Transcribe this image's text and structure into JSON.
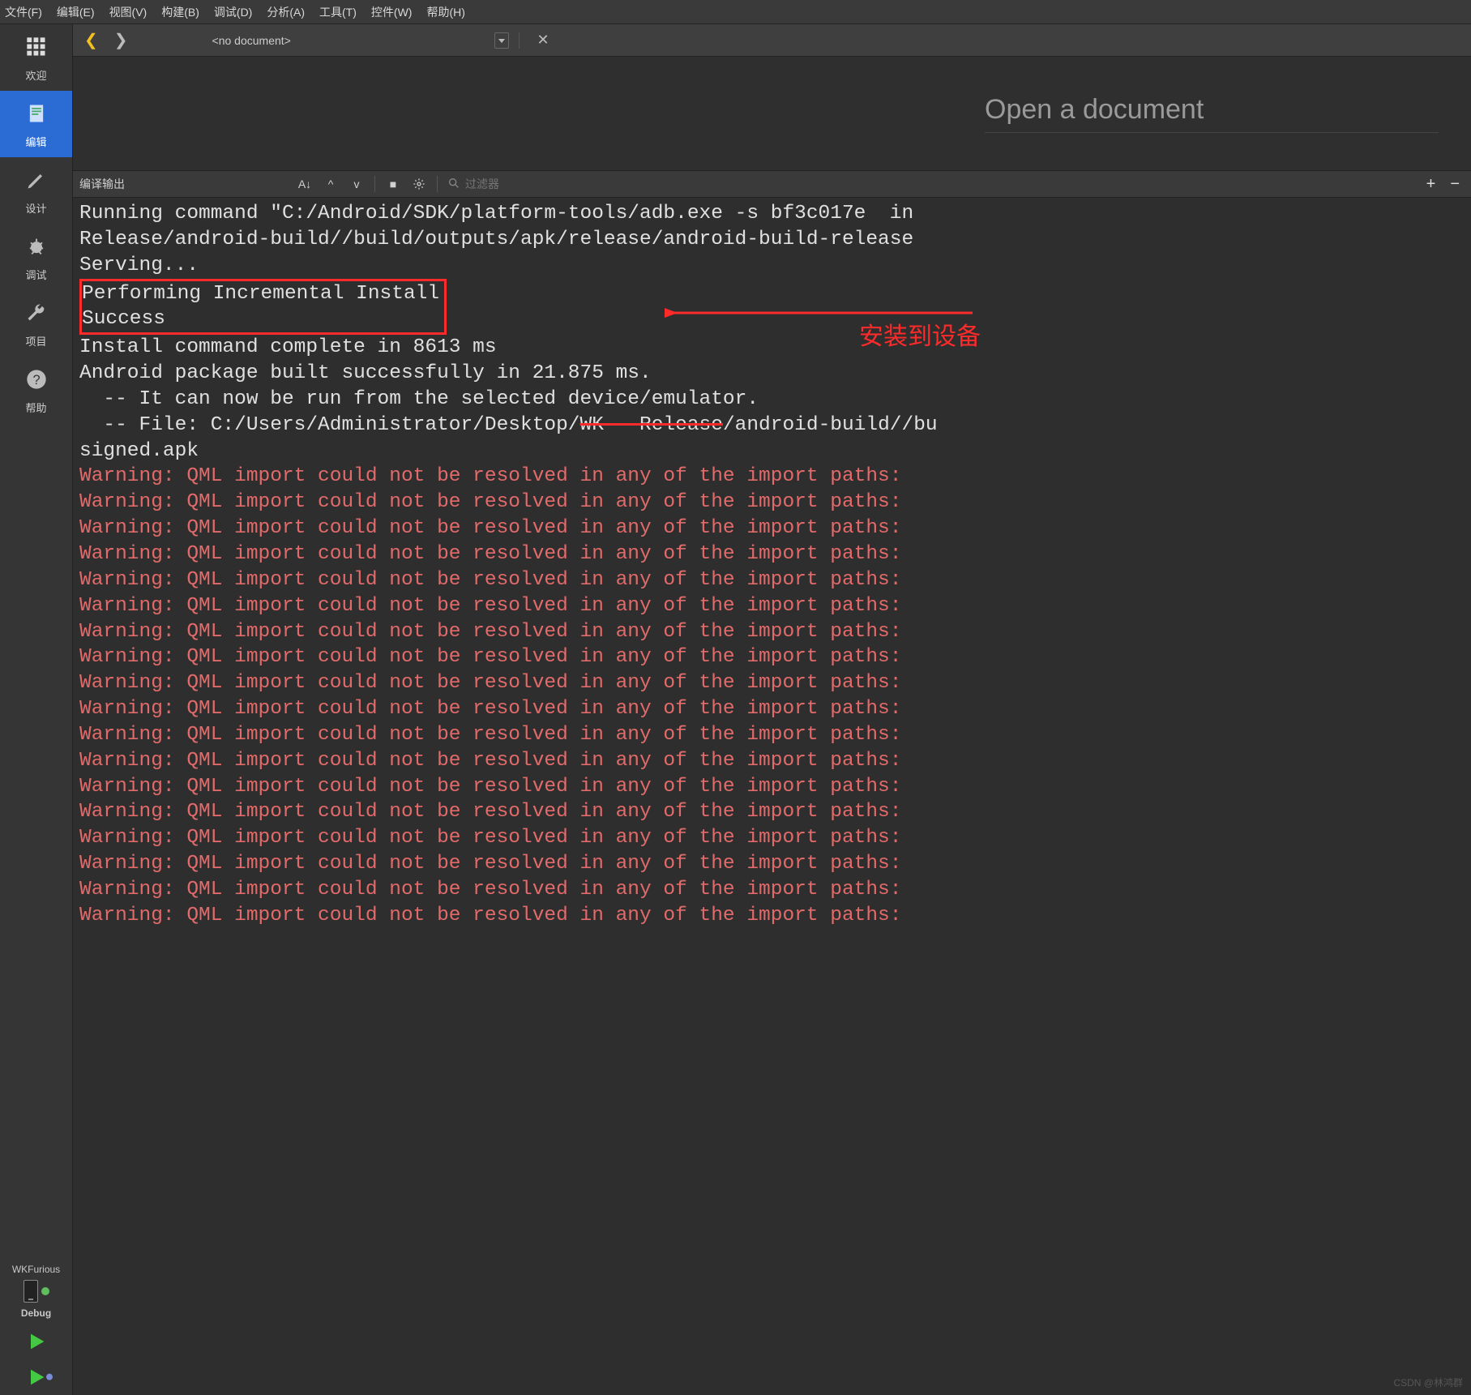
{
  "menu": {
    "file": "文件(F)",
    "edit": "编辑(E)",
    "view": "视图(V)",
    "build": "构建(B)",
    "debug": "调试(D)",
    "analyze": "分析(A)",
    "tools": "工具(T)",
    "controls": "控件(W)",
    "help": "帮助(H)"
  },
  "sidebar": {
    "items": [
      {
        "id": "welcome",
        "label": "欢迎",
        "icon": "grid"
      },
      {
        "id": "editor",
        "label": "编辑",
        "icon": "doc",
        "active": true
      },
      {
        "id": "design",
        "label": "设计",
        "icon": "pencil"
      },
      {
        "id": "debug",
        "label": "调试",
        "icon": "bug"
      },
      {
        "id": "project",
        "label": "项目",
        "icon": "wrench"
      },
      {
        "id": "help",
        "label": "帮助",
        "icon": "question"
      }
    ],
    "kit_name": "WKFurious",
    "build_mode": "Debug"
  },
  "doc_nav": {
    "label": "<no document>"
  },
  "placeholder": {
    "open_doc": "Open a document"
  },
  "out_header": {
    "title": "编译输出",
    "filter_placeholder": "过滤器"
  },
  "output": {
    "lines_normal": [
      "Running command \"C:/Android/SDK/platform-tools/adb.exe -s bf3c017e  in",
      "Release/android-build//build/outputs/apk/release/android-build-release",
      "Serving..."
    ],
    "boxed": [
      "Performing Incremental Install",
      "Success"
    ],
    "after_box": [
      "Install command complete in 8613 ms",
      "Android package built successfully in 21.875 ms.",
      "  -- It can now be run from the selected device/emulator."
    ],
    "file_line_prefix": "  -- File: C:/Users/Administrator/Desktop/",
    "file_line_struck": "WK   Release",
    "file_line_suffix": "/android-build//bu",
    "signed_line": "signed.apk",
    "warning_text": "Warning: QML import could not be resolved in any of the import paths:",
    "warning_count": 18
  },
  "annotation": {
    "label": "安装到设备"
  },
  "watermark": "CSDN @林鸿群"
}
